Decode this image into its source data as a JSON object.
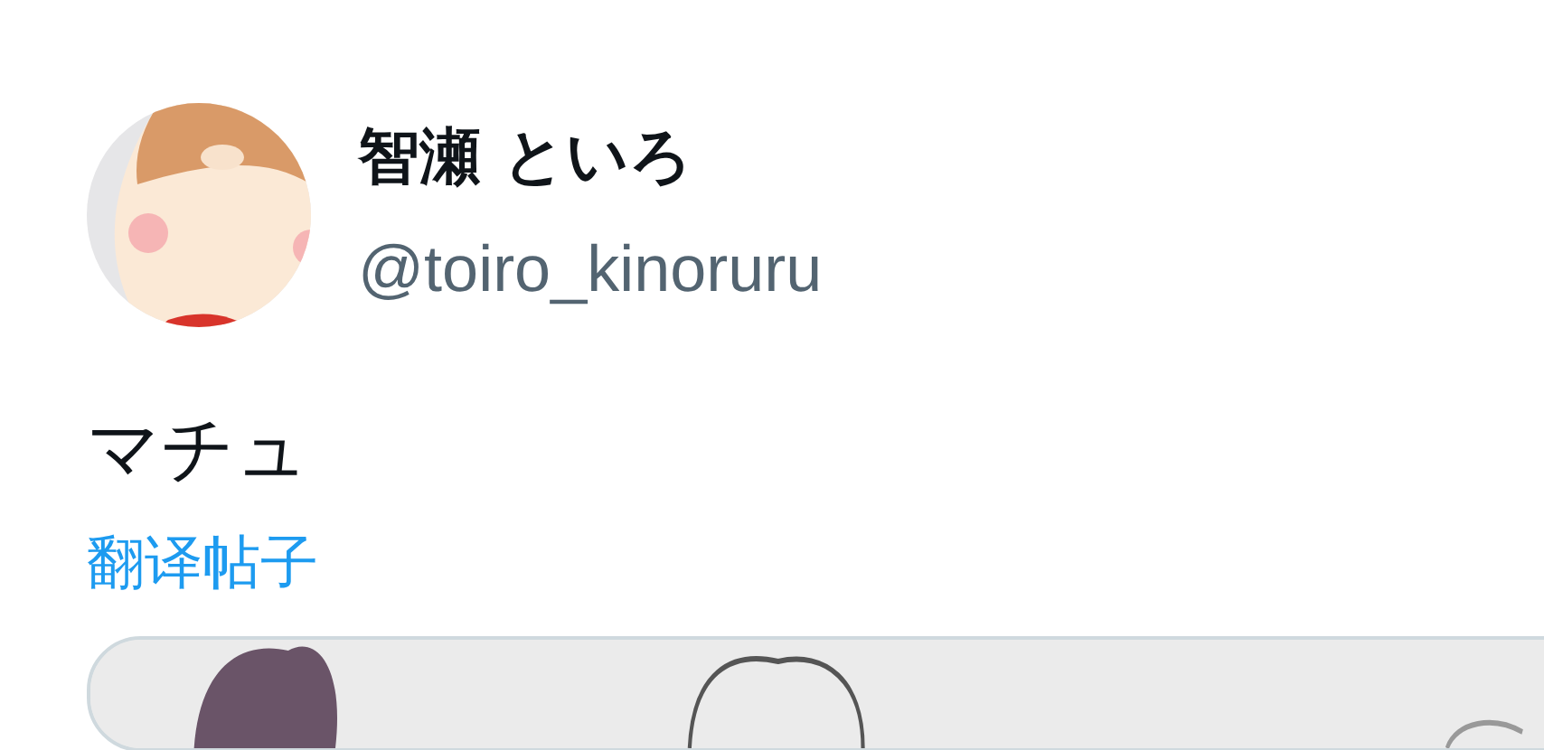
{
  "author": {
    "name": "智瀬 といろ",
    "handle": "@toiro_kinoruru"
  },
  "post": {
    "text": "マチュ",
    "translate_link": "翻译帖子"
  }
}
